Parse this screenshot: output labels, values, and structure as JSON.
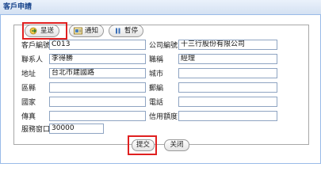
{
  "window": {
    "title": "客戶申請"
  },
  "toolbar": {
    "send_label": "呈送",
    "notify_label": "通知",
    "pause_label": "暫停"
  },
  "form": {
    "customer_no_label": "客戶編號",
    "customer_no_value": "C013",
    "company_no_label": "公司編號",
    "company_no_value": "十三行股份有限公司",
    "contact_label": "聯系人",
    "contact_value": "李得勝",
    "title_label": "職稱",
    "title_value": "經理",
    "address_label": "地址",
    "address_value": "台北市建國路",
    "city_label": "城市",
    "city_value": "",
    "region_label": "區縣",
    "region_value": "",
    "zip_label": "郵編",
    "zip_value": "",
    "country_label": "國家",
    "country_value": "",
    "phone_label": "電話",
    "phone_value": "",
    "fax_label": "傳真",
    "fax_value": "",
    "credit_label": "信用額度",
    "credit_value": "",
    "service_label": "服務窗口",
    "service_value": "30000"
  },
  "footer": {
    "submit_label": "提交",
    "close_label": "关闭"
  },
  "colors": {
    "highlight": "#e02020",
    "title_text": "#15428b",
    "field_border": "#8ea4c2"
  }
}
